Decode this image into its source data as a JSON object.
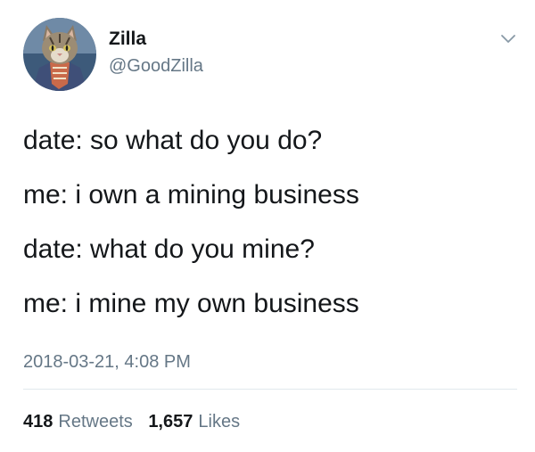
{
  "tweet": {
    "author": {
      "display_name": "Zilla",
      "handle": "@GoodZilla"
    },
    "lines": [
      "date: so what do you do?",
      "me: i own a mining business",
      "date: what do you mine?",
      "me: i mine my own business"
    ],
    "timestamp": "2018-03-21, 4:08 PM",
    "stats": {
      "retweets_count": "418",
      "retweets_label": "Retweets",
      "likes_count": "1,657",
      "likes_label": "Likes"
    }
  },
  "icons": {
    "menu": "chevron-down-icon",
    "avatar": "cat-avatar"
  },
  "colors": {
    "text": "#14171a",
    "secondary": "#657786",
    "divider": "#e1e8ed"
  }
}
